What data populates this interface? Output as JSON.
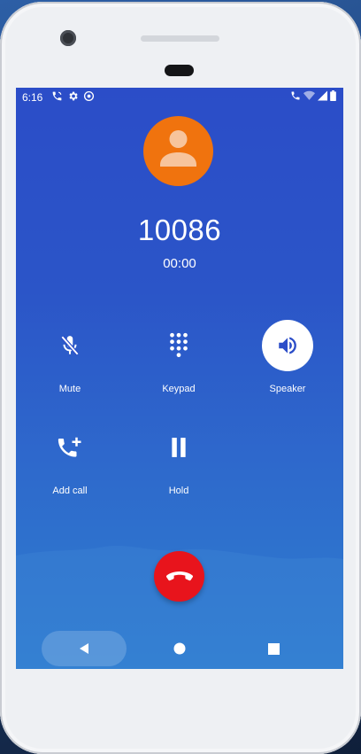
{
  "status_bar": {
    "time": "6:16",
    "left_icons": [
      "wifi-calling-icon",
      "settings-icon",
      "sync-icon"
    ],
    "right_icons": [
      "wifi-calling-icon",
      "wifi-icon",
      "signal-icon",
      "battery-icon"
    ]
  },
  "call": {
    "number": "10086",
    "duration": "00:00"
  },
  "controls": {
    "mute_label": "Mute",
    "keypad_label": "Keypad",
    "speaker_label": "Speaker",
    "add_call_label": "Add call",
    "hold_label": "Hold"
  },
  "states": {
    "speaker_active": true,
    "mute_active": false
  },
  "colors": {
    "avatar": "#f0730e",
    "end_call": "#e8141c",
    "screen_top": "#2b4dc8",
    "screen_bottom": "#2f7ecf"
  },
  "nav": {
    "icons": [
      "back-icon",
      "home-icon",
      "recents-icon"
    ]
  }
}
